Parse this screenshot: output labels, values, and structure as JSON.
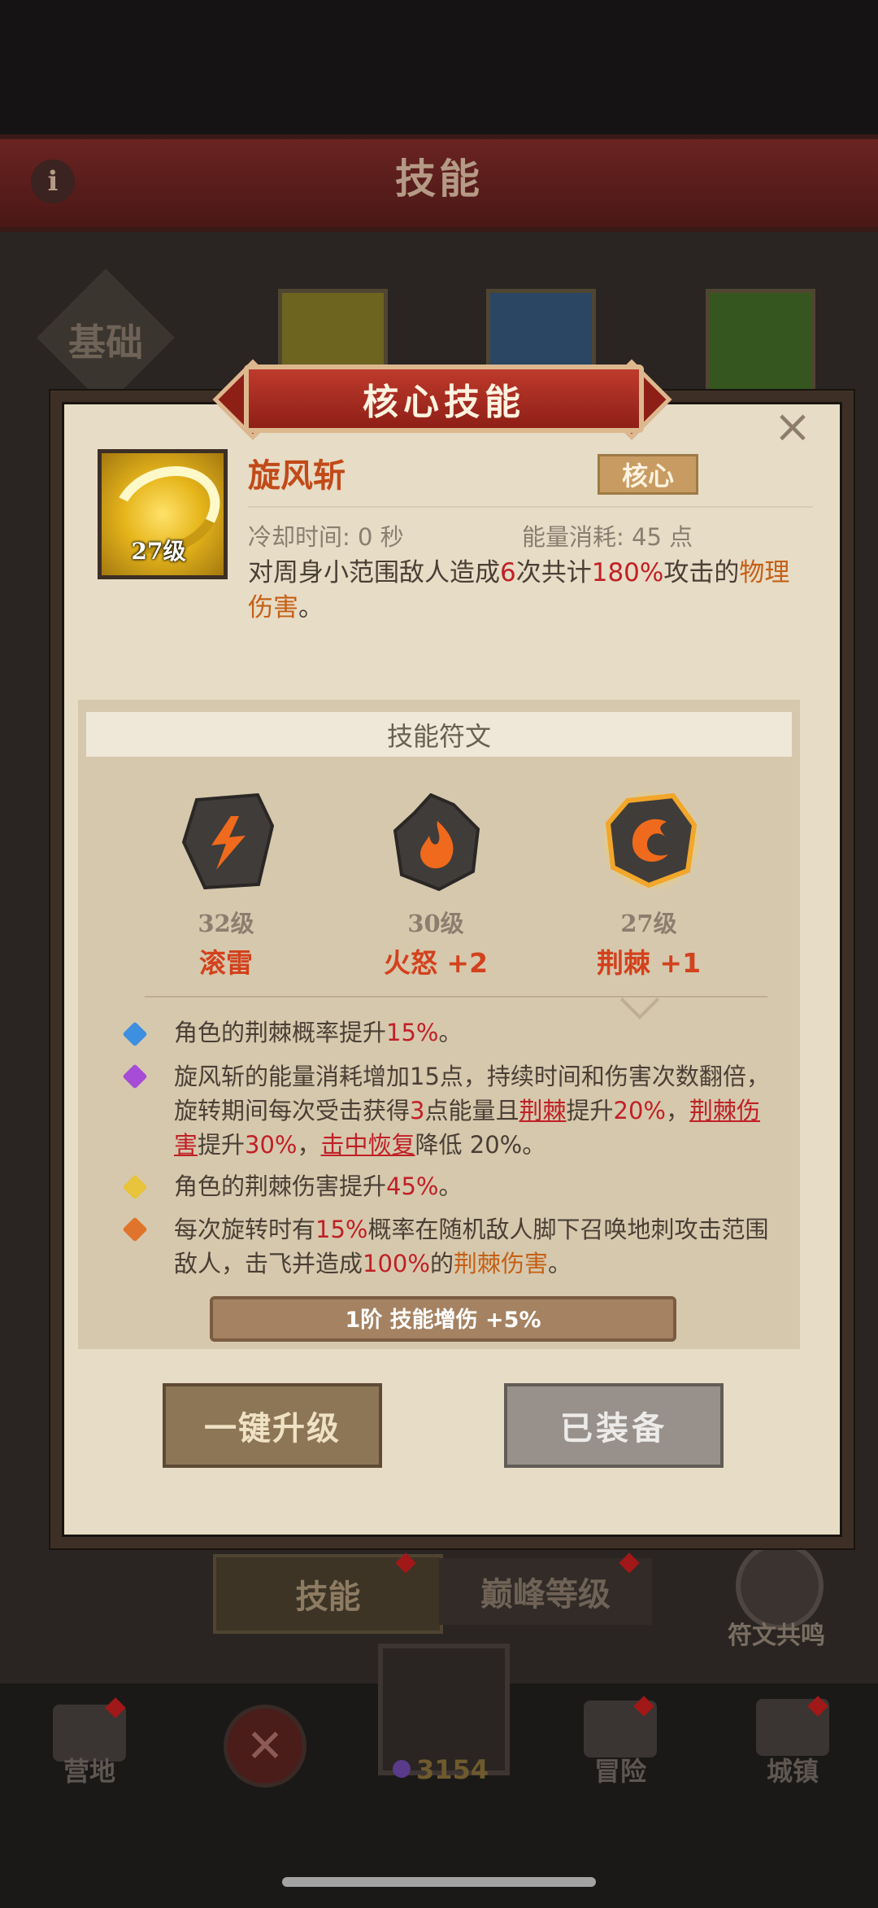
{
  "background": {
    "banner_title": "技能",
    "base_tab": "基础",
    "bottom_tabs": {
      "skill": "技能",
      "peak_level": "巅峰等级"
    },
    "rune_resonance": "符文共鸣",
    "nav": {
      "camp": "营地",
      "adventure": "冒险",
      "town": "城镇",
      "currency": "3154"
    }
  },
  "dialog": {
    "title": "核心技能",
    "close_symbol": "×",
    "skill": {
      "name": "旋风斩",
      "level": "27级",
      "badge": "核心",
      "cooldown": "冷却时间: 0 秒",
      "energy": "能量消耗: 45 点",
      "desc": {
        "p1": "对周身小范围敌人造成",
        "n1": "6",
        "p2": "次共计",
        "n2": "180%",
        "p3": "攻击的",
        "term": "物理伤害",
        "p4": "。"
      }
    },
    "rune_panel": {
      "title": "技能符文",
      "runes": [
        {
          "level": "32级",
          "name": "滚雷",
          "icon": "thunder-rune-icon"
        },
        {
          "level": "30级",
          "name": "火怒 +2",
          "icon": "fire-rune-icon"
        },
        {
          "level": "27级",
          "name": "荆棘 +1",
          "icon": "thorn-rune-icon"
        }
      ],
      "effects": {
        "e1": {
          "p1": "角色的荆棘概率提升",
          "v1": "15%",
          "p2": "。"
        },
        "e2": {
          "p1": "旋风斩的能量消耗增加15点，持续时间和伤害次数翻倍，旋转期间每次受击获得",
          "v1": "3",
          "p2": "点能量且",
          "t1": "荆棘",
          "p3": "提升",
          "v2": "20%",
          "p4": "，",
          "t2": "荆棘伤害",
          "p5": "提升",
          "v3": "30%",
          "p6": "，",
          "t3": "击中恢复",
          "p7": "降低 20%。"
        },
        "e3": {
          "p1": "角色的荆棘伤害提升",
          "v1": "45%",
          "p2": "。"
        },
        "e4": {
          "p1": "每次旋转时有",
          "v1": "15%",
          "p2": "概率在随机敌人脚下召唤地刺攻击范围敌人，击飞并造成",
          "v2": "100%",
          "p3": "的",
          "t1": "荆棘伤害",
          "p4": "。"
        }
      },
      "stage_bonus": "1阶 技能增伤 +5%"
    },
    "buttons": {
      "upgrade": "一键升级",
      "equipped": "已装备"
    }
  },
  "colors": {
    "bullet_blue": "#3d8fe0",
    "bullet_purple": "#a64cd6",
    "bullet_yellow": "#e8c33c",
    "bullet_orange": "#e0742c",
    "highlight_red": "#c02026",
    "highlight_orange": "#c56016"
  }
}
